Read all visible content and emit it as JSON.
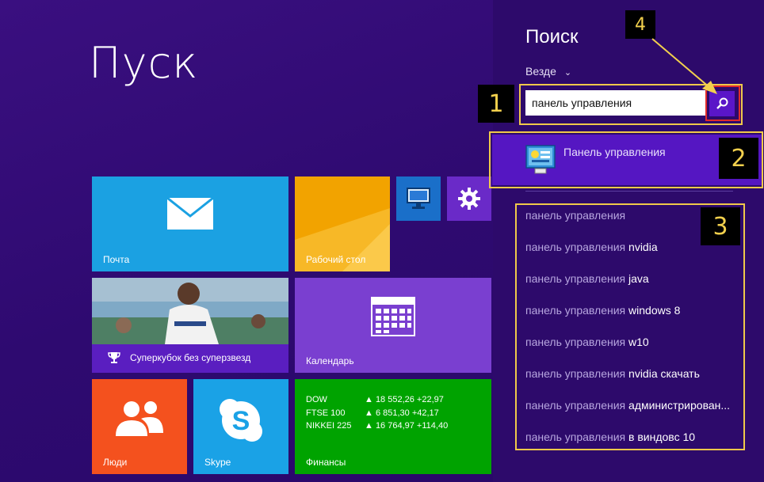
{
  "start": {
    "title": "Пуск",
    "tiles": {
      "mail": "Почта",
      "desktop": "Рабочий стол",
      "sports": "Суперкубок без суперзвезд",
      "calendar": "Календарь",
      "people": "Люди",
      "skype": "Skype",
      "finance": "Финансы"
    },
    "finance_rows": [
      {
        "index": "DOW",
        "value": "▲ 18 552,26 +22,97"
      },
      {
        "index": "FTSE 100",
        "value": "▲ 6 851,30 +42,17"
      },
      {
        "index": "NIKKEI 225",
        "value": "▲ 16 764,97 +114,40"
      }
    ]
  },
  "search": {
    "title": "Поиск",
    "scope": "Везде",
    "query": "панель управления",
    "top_result": "Панель управления",
    "suggestion_prefix": "панель управления",
    "suggestions": [
      {
        "rest": ""
      },
      {
        "rest": " nvidia"
      },
      {
        "rest": " java"
      },
      {
        "rest": " windows 8"
      },
      {
        "rest": " w10"
      },
      {
        "rest": " nvidia скачать"
      },
      {
        "rest": " администрирован..."
      },
      {
        "rest": " в виндовс 10"
      }
    ]
  },
  "annotations": {
    "badge1": "1",
    "badge2": "2",
    "badge3": "3",
    "badge4": "4",
    "box_color": "#f0c94a",
    "button_box_color": "#e02b2b",
    "arrow_color": "#f2d04d"
  },
  "colors": {
    "mail": "#1ba1e2",
    "desktop": "#f2a300",
    "people": "#f4511e",
    "skype": "#1aa2e6",
    "finance": "#00a300",
    "calendar": "#7a3fd0",
    "accent": "#5a16c8"
  }
}
